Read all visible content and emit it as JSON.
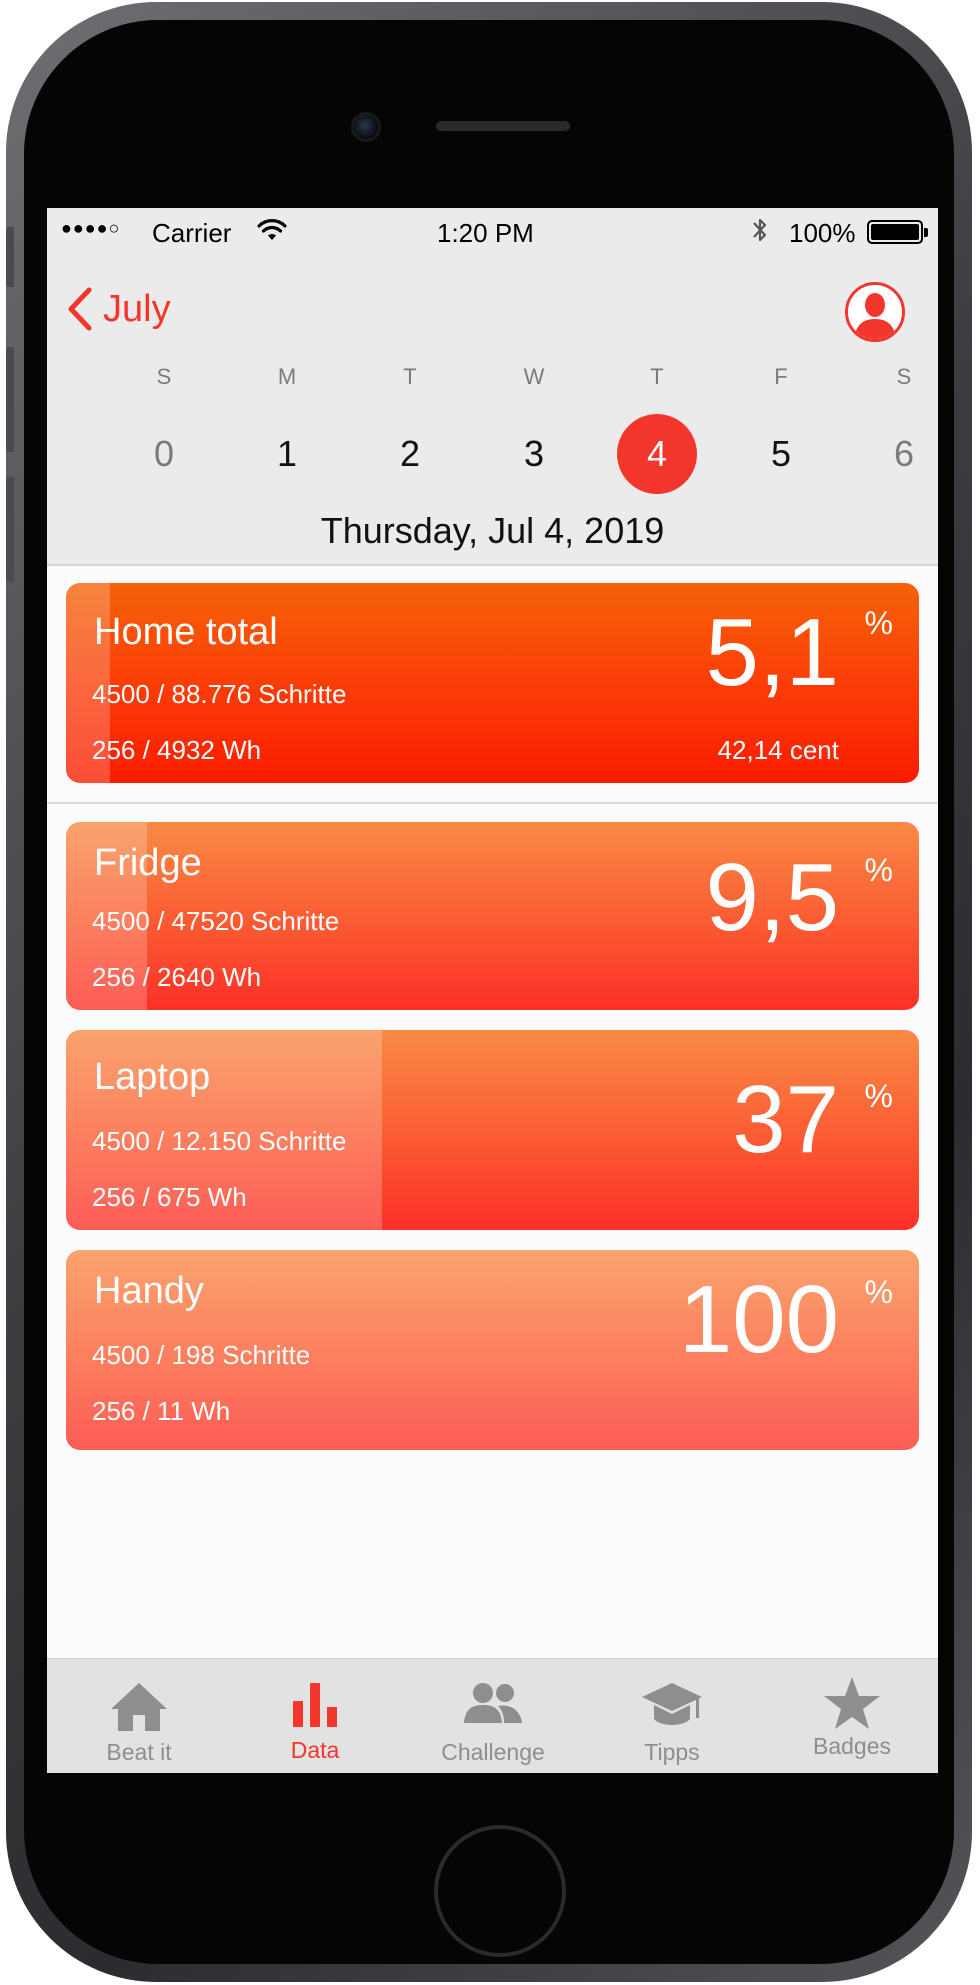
{
  "status_bar": {
    "signal": "●●●●○",
    "carrier": "Carrier",
    "time": "1:20 PM",
    "battery_percent": "100%"
  },
  "header": {
    "back_label": "July",
    "weekdays": [
      "S",
      "M",
      "T",
      "W",
      "T",
      "F",
      "S"
    ],
    "days": [
      "0",
      "1",
      "2",
      "3",
      "4",
      "5",
      "6"
    ],
    "selected_day": "4",
    "date_title": "Thursday, Jul 4, 2019"
  },
  "summary": {
    "name": "Home total",
    "steps": "4500 / 88.776 Schritte",
    "energy": "256 / 4932 Wh",
    "value": "5,1",
    "unit": "%",
    "cost": "42,14 cent",
    "progress": 0.051
  },
  "devices": [
    {
      "name": "Fridge",
      "steps": "4500 / 47520 Schritte",
      "energy": "256 / 2640 Wh",
      "value": "9,5",
      "unit": "%",
      "progress": 0.095
    },
    {
      "name": "Laptop",
      "steps": "4500 / 12.150 Schritte",
      "energy": "256 / 675 Wh",
      "value": "37",
      "unit": "%",
      "progress": 0.37
    },
    {
      "name": "Handy",
      "steps": "4500 / 198 Schritte",
      "energy": "256 / 11 Wh",
      "value": "100",
      "unit": "%",
      "progress": 1.0
    }
  ],
  "tabbar": {
    "items": [
      {
        "label": "Beat it",
        "icon": "home-icon"
      },
      {
        "label": "Data",
        "icon": "bar-chart-icon"
      },
      {
        "label": "Challenge",
        "icon": "group-icon"
      },
      {
        "label": "Tipps",
        "icon": "graduation-cap-icon"
      },
      {
        "label": "Badges",
        "icon": "star-icon"
      }
    ],
    "active_index": 1
  },
  "colors": {
    "accent": "#f2362b",
    "card_total_top": "#f66208",
    "card_total_bottom": "#fd1c00",
    "card_device_top": "#f98a45",
    "card_device_bottom": "#fd2f27",
    "tab_inactive": "#8e8e8e"
  }
}
